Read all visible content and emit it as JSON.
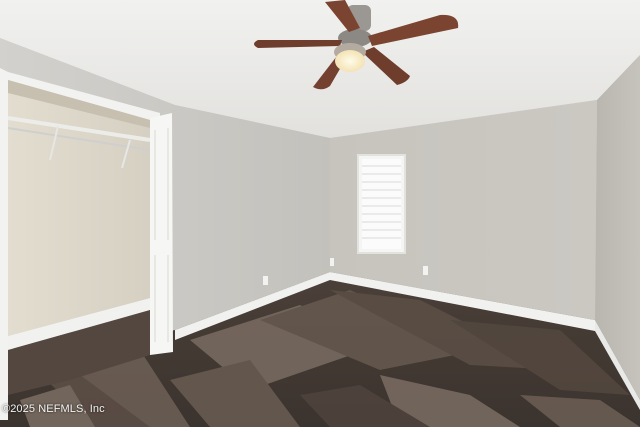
{
  "photo": {
    "watermark": "©2025 NEFMLS, Inc"
  },
  "colors": {
    "ceiling": "#ececea",
    "wall_left": "#cfcdc9",
    "wall_back": "#c9c6c0",
    "wall_right": "#bfbcb6",
    "closet_interior": "#ddd7cb",
    "baseboard": "#f3f3f1",
    "floor_dark": "#3d3530",
    "floor_mid": "#5a4d44",
    "floor_light": "#7d6f64",
    "fan_blade": "#7a4431",
    "window_light": "#f7f8f9"
  }
}
